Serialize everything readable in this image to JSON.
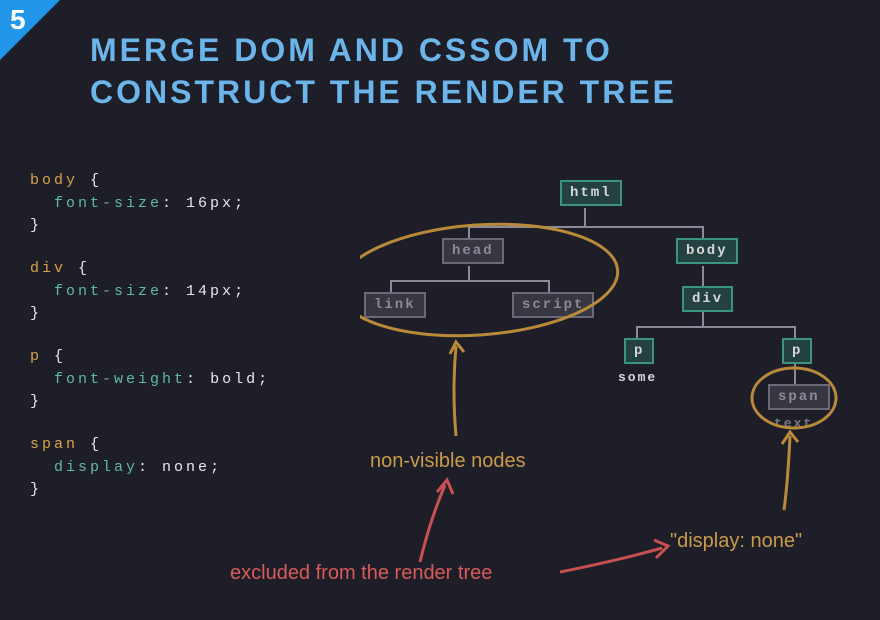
{
  "slideNumber": "5",
  "title": "MERGE DOM AND CSSOM TO CONSTRUCT THE RENDER TREE",
  "css": [
    {
      "selector": "body",
      "prop": "font-size",
      "val": "16px"
    },
    {
      "selector": "div",
      "prop": "font-size",
      "val": "14px"
    },
    {
      "selector": "p",
      "prop": "font-weight",
      "val": "bold"
    },
    {
      "selector": "span",
      "prop": "display",
      "val": "none"
    }
  ],
  "nodes": {
    "html": "html",
    "head": "head",
    "link": "link",
    "script": "script",
    "body": "body",
    "div": "div",
    "p1": "p",
    "p2": "p",
    "span": "span"
  },
  "leafText": {
    "some": "some",
    "text": "text"
  },
  "annotations": {
    "nonVisible": "non-visible nodes",
    "displayNone": "\"display: none\"",
    "excluded": "excluded from the render tree"
  }
}
